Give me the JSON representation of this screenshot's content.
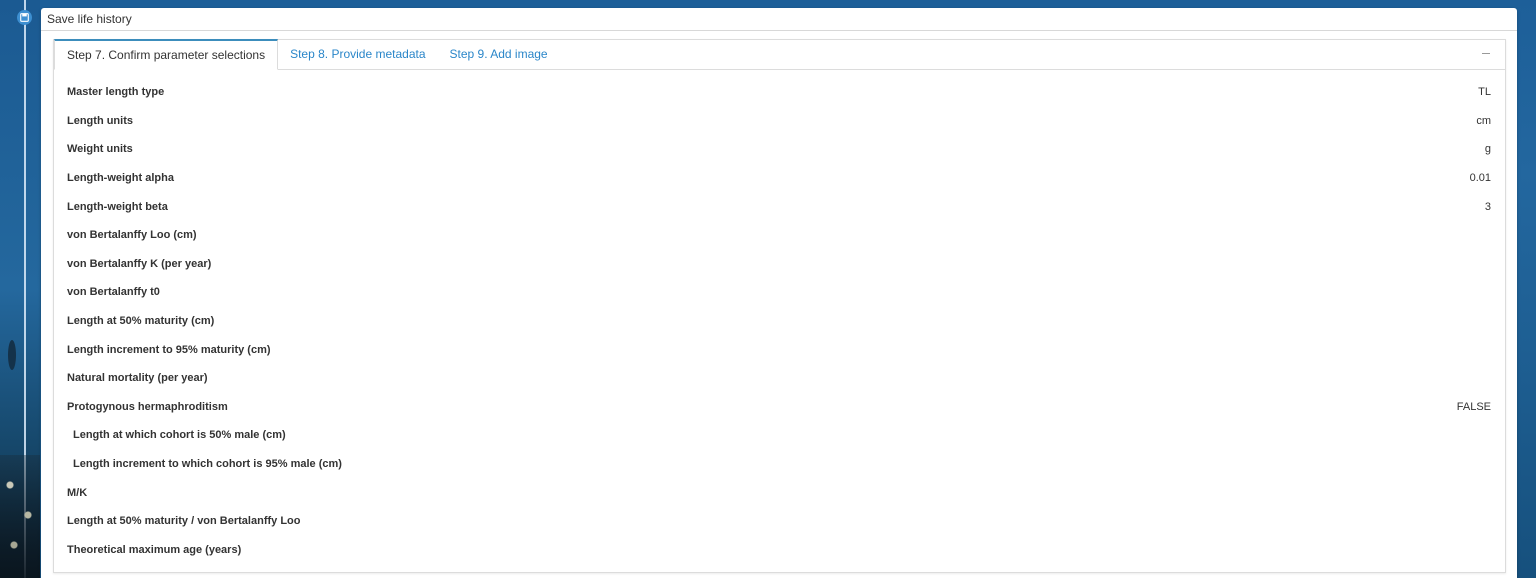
{
  "window": {
    "title": "Save life history"
  },
  "icons": {
    "save": "save-icon",
    "collapse": "minus-icon"
  },
  "tabs": [
    {
      "label": "Step 7. Confirm parameter selections",
      "active": true
    },
    {
      "label": "Step 8. Provide metadata",
      "active": false
    },
    {
      "label": "Step 9. Add image",
      "active": false
    }
  ],
  "parameters": [
    {
      "label": "Master length type",
      "value": "TL"
    },
    {
      "label": "Length units",
      "value": "cm"
    },
    {
      "label": "Weight units",
      "value": "g"
    },
    {
      "label": "Length-weight alpha",
      "value": "0.01"
    },
    {
      "label": "Length-weight beta",
      "value": "3"
    },
    {
      "label": "von Bertalanffy Loo (cm)",
      "value": ""
    },
    {
      "label": "von Bertalanffy K (per year)",
      "value": ""
    },
    {
      "label": "von Bertalanffy t0",
      "value": ""
    },
    {
      "label": "Length at 50% maturity (cm)",
      "value": ""
    },
    {
      "label": "Length increment to 95% maturity (cm)",
      "value": ""
    },
    {
      "label": "Natural mortality (per year)",
      "value": ""
    },
    {
      "label": "Protogynous hermaphroditism",
      "value": "FALSE"
    },
    {
      "label": "Length at which cohort is 50% male (cm)",
      "value": ""
    },
    {
      "label": "Length increment to which cohort is 95% male (cm)",
      "value": ""
    },
    {
      "label": "M/K",
      "value": ""
    },
    {
      "label": "Length at 50% maturity / von Bertalanffy Loo",
      "value": ""
    },
    {
      "label": "Theoretical maximum age (years)",
      "value": ""
    }
  ],
  "colors": {
    "accent": "#3c8dbc",
    "link": "#2a86c9",
    "text": "#333333"
  }
}
